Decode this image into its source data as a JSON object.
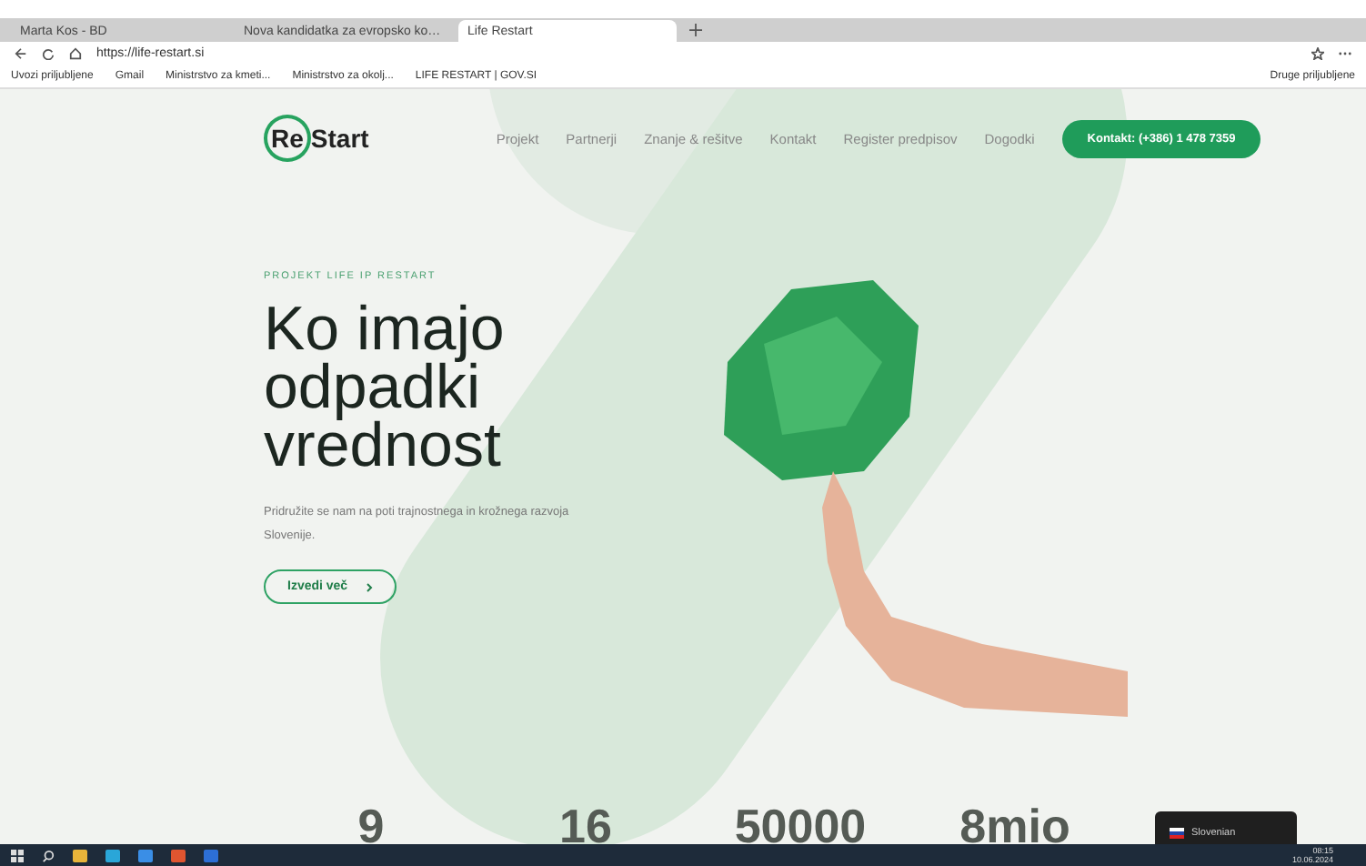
{
  "browser": {
    "tabs": [
      {
        "label": "Marta Kos - BD",
        "selected": false
      },
      {
        "label": "Nova kandidatka za evropsko ko…",
        "selected": false
      },
      {
        "label": "Life Restart",
        "selected": true
      }
    ],
    "address": "https://life-restart.si",
    "bookmarks": [
      "Uvozi priljubljene",
      "Gmail",
      "Ministrstvo za kmeti...",
      "Ministrstvo za okolj...",
      "LIFE RESTART | GOV.SI"
    ],
    "other_bookmarks": "Druge priljubljene"
  },
  "site": {
    "logo": {
      "part_1": "Re",
      "part_2": "Start"
    },
    "nav": [
      {
        "label": "Projekt"
      },
      {
        "label": "Partnerji"
      },
      {
        "label": "Znanje & rešitve"
      },
      {
        "label": "Kontakt"
      },
      {
        "label": "Register predpisov"
      },
      {
        "label": "Dogodki"
      }
    ],
    "contact_button": "Kontakt: (+386) 1 478 7359",
    "eyebrow": "PROJEKT LIFE IP RESTART",
    "heading": [
      "Ko imajo",
      "odpadki",
      "vrednost"
    ],
    "lead": "Pridružite se nam na poti trajnostnega in krožnega razvoja Slovenije.",
    "cta": "Izvedi več",
    "stats": [
      "9",
      "16",
      "50000",
      "8mio"
    ],
    "language": "Slovenian"
  },
  "taskbar": {
    "time": "08:15",
    "date": "10.06.2024"
  }
}
